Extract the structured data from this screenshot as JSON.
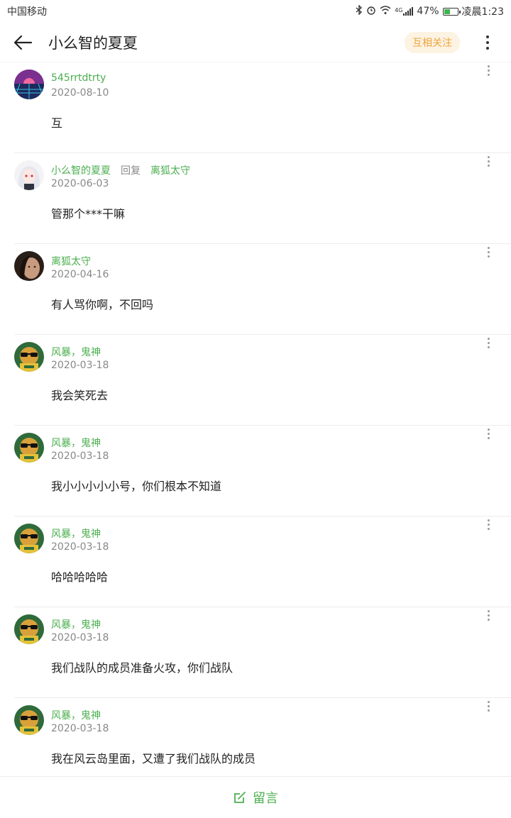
{
  "status_bar": {
    "carrier": "中国移动",
    "network": "4G",
    "battery": "47%",
    "battery_level": 0.47,
    "time": "凌晨1:23"
  },
  "header": {
    "title": "小么智的夏夏",
    "follow_badge": "互相关注"
  },
  "comments": [
    {
      "name": "545rrtdtrty",
      "date": "2020-08-10",
      "text": "互",
      "avatar": "sunset-avatar"
    },
    {
      "name": "小么智的夏夏",
      "reply_label": "回复",
      "reply_to": "离狐太守",
      "date": "2020-06-03",
      "text": "管那个***干嘛",
      "avatar": "anime-girl-avatar"
    },
    {
      "name": "离狐太守",
      "date": "2020-04-16",
      "text": "有人骂你啊，不回吗",
      "avatar": "face-avatar"
    },
    {
      "name": "风暴，鬼神",
      "date": "2020-03-18",
      "text": "我会笑死去",
      "avatar": "sunglasses-avatar"
    },
    {
      "name": "风暴，鬼神",
      "date": "2020-03-18",
      "text": "我小小小小小号，你们根本不知道",
      "avatar": "sunglasses-avatar"
    },
    {
      "name": "风暴，鬼神",
      "date": "2020-03-18",
      "text": "哈哈哈哈哈",
      "avatar": "sunglasses-avatar"
    },
    {
      "name": "风暴，鬼神",
      "date": "2020-03-18",
      "text": "我们战队的成员准备火攻，你们战队",
      "avatar": "sunglasses-avatar"
    },
    {
      "name": "风暴，鬼神",
      "date": "2020-03-18",
      "text": "我在风云岛里面，又遭了我们战队的成员",
      "avatar": "sunglasses-avatar"
    }
  ],
  "bottom": {
    "label": "留言"
  },
  "colors": {
    "accent_green": "#4caf50",
    "follow_orange": "#f0a33a"
  }
}
